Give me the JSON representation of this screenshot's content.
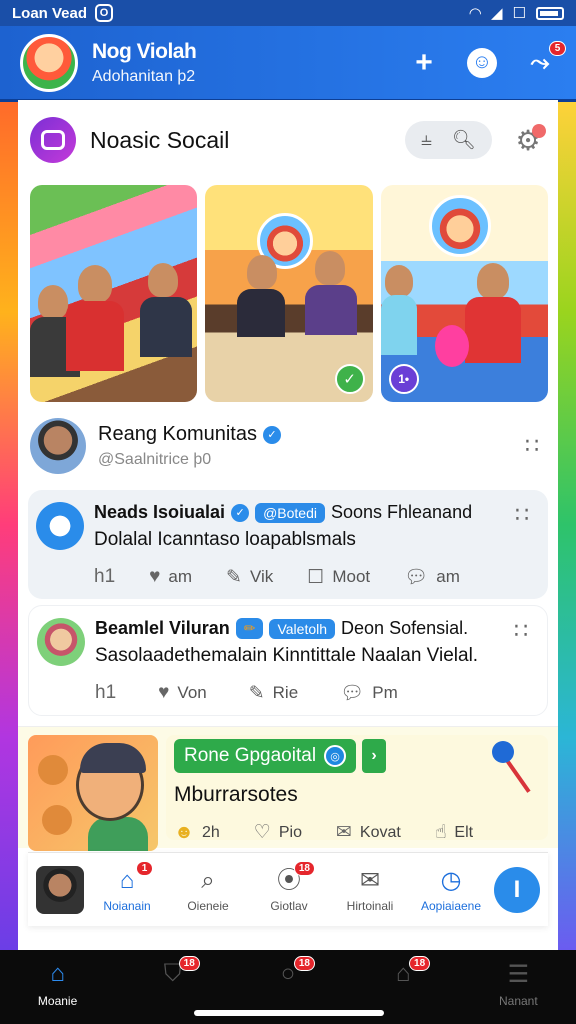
{
  "status_bar": {
    "left_text": "Loan Vead",
    "badge": "O"
  },
  "header": {
    "title": "Nog Violah",
    "subtitle": "Adohanitan þ2",
    "plus_icon": "+",
    "notification_count": "5"
  },
  "section": {
    "title": "Noasic Socail"
  },
  "gallery": {
    "photo2_badge": "✓",
    "photo3_badge": "1•"
  },
  "community": {
    "title": "Reang Komunitas",
    "subtitle": "@Saalnitrice þ0"
  },
  "posts": [
    {
      "author": "Neads Isoiualai",
      "tag": "@Botedi",
      "extra": "Soons Fhleanand",
      "text": "Dolalal Icanntaso loapablsmals",
      "actions": [
        {
          "icon": "h1",
          "label": ""
        },
        {
          "icon": "heart-icon",
          "label": "am"
        },
        {
          "icon": "pencil-icon",
          "label": "Vik"
        },
        {
          "icon": "save-icon",
          "label": "Moot"
        },
        {
          "icon": "comment-icon",
          "label": "am"
        }
      ]
    },
    {
      "author": "Beamlel Viluran",
      "tag": "Valetolh",
      "extra": "Deon Sofensial.",
      "text": "Sasolaadethemalain Kinntittale Naalan Vielal.",
      "actions": [
        {
          "icon": "h1",
          "label": ""
        },
        {
          "icon": "heart-icon",
          "label": "Von"
        },
        {
          "icon": "pencil-icon",
          "label": "Rie"
        },
        {
          "icon": "comment-icon",
          "label": "Pm"
        }
      ]
    }
  ],
  "promo": {
    "button_label": "Rone Gpgaoital",
    "title": "Mburrarsotes",
    "actions": [
      {
        "icon": "emoji-icon",
        "label": "2h"
      },
      {
        "icon": "heart-icon",
        "label": "Pio"
      },
      {
        "icon": "comment-icon",
        "label": "Kovat"
      },
      {
        "icon": "thumb-icon",
        "label": "Elt"
      }
    ]
  },
  "bottom_tabs": [
    {
      "label": "Noianain",
      "badge": "1",
      "active": true
    },
    {
      "label": "Oieneie",
      "badge": "",
      "active": false
    },
    {
      "label": "Giotlav",
      "badge": "18",
      "active": false
    },
    {
      "label": "Hirtoinali",
      "badge": "",
      "active": false
    },
    {
      "label": "Aopiaiaene",
      "badge": "",
      "active": true
    }
  ],
  "fab_label": "I",
  "system_nav": [
    {
      "label": "Moanie",
      "badge": "",
      "active": true
    },
    {
      "label": "",
      "badge": "18",
      "active": false
    },
    {
      "label": "",
      "badge": "18",
      "active": false
    },
    {
      "label": "",
      "badge": "18",
      "active": false
    },
    {
      "label": "Nanant",
      "badge": "",
      "active": false
    }
  ],
  "colors": {
    "primary": "#2b7ef0",
    "accent_green": "#2eaa4a",
    "badge_red": "#e5262c"
  }
}
